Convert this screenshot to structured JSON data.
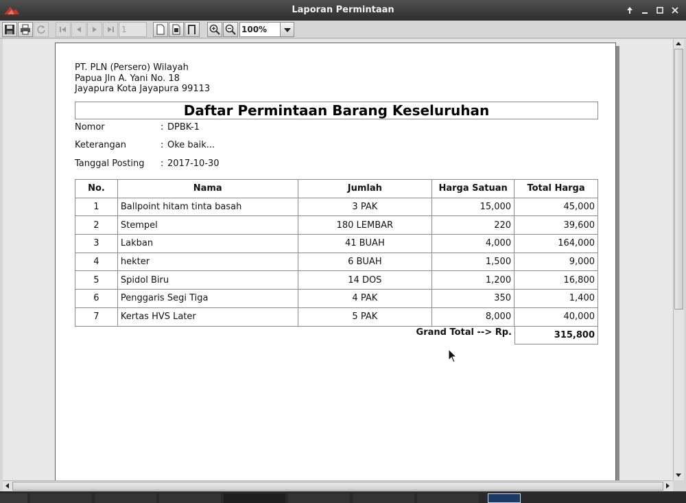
{
  "window": {
    "title": "Laporan Permintaan"
  },
  "toolbar": {
    "page_number": "1",
    "zoom": "100%"
  },
  "report": {
    "company_lines": [
      "PT. PLN (Persero) Wilayah",
      "Papua Jln A. Yani No. 18",
      "Jayapura Kota Jayapura 99113"
    ],
    "title": "Daftar Permintaan Barang Keseluruhan",
    "meta": [
      {
        "label": "Nomor",
        "value": "DPBK-1"
      },
      {
        "label": "Keterangan",
        "value": "Oke baik..."
      },
      {
        "label": "Tanggal Posting",
        "value": "2017-10-30"
      }
    ],
    "colon": ":",
    "columns": [
      "No.",
      "Nama",
      "Jumlah",
      "Harga Satuan",
      "Total Harga"
    ],
    "rows": [
      [
        "1",
        "Ballpoint hitam tinta basah",
        "3 PAK",
        "15,000",
        "45,000"
      ],
      [
        "2",
        "Stempel",
        "180 LEMBAR",
        "220",
        "39,600"
      ],
      [
        "3",
        "Lakban",
        "41 BUAH",
        "4,000",
        "164,000"
      ],
      [
        "4",
        "hekter",
        "6 BUAH",
        "1,500",
        "9,000"
      ],
      [
        "5",
        "Spidol Biru",
        "14 DOS",
        "1,200",
        "16,800"
      ],
      [
        "6",
        "Penggaris Segi Tiga",
        "4 PAK",
        "350",
        "1,400"
      ],
      [
        "7",
        "Kertas HVS Later",
        "5 PAK",
        "8,000",
        "40,000"
      ]
    ],
    "grand_total_label": "Grand Total --> Rp.",
    "grand_total": "315,800"
  },
  "colors": {
    "titlebar": "#3a3a3a",
    "page": "#ffffff",
    "toolbar": "#d6d6d6",
    "viewport": "#e8e8e8"
  }
}
